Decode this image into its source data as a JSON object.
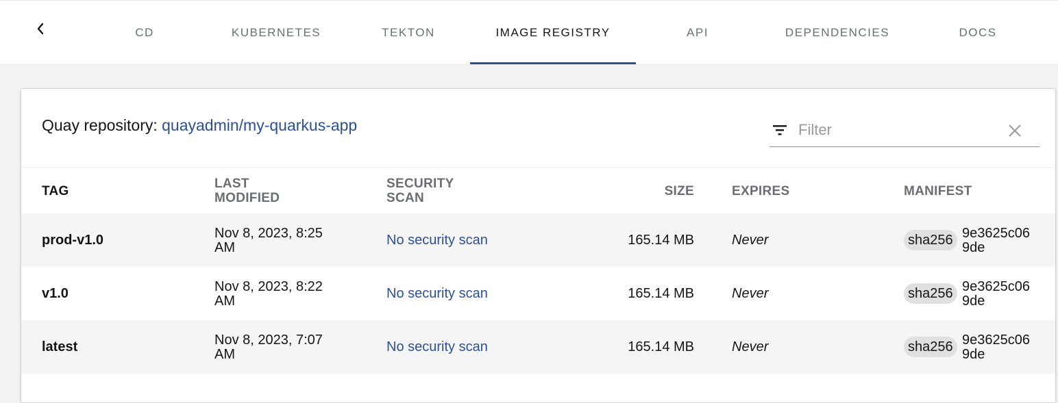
{
  "tabs": [
    {
      "label": "CD"
    },
    {
      "label": "KUBERNETES"
    },
    {
      "label": "TEKTON"
    },
    {
      "label": "IMAGE REGISTRY",
      "active": true
    },
    {
      "label": "API"
    },
    {
      "label": "DEPENDENCIES"
    },
    {
      "label": "DOCS"
    }
  ],
  "repository": {
    "prefix": "Quay repository: ",
    "name": "quayadmin/my-quarkus-app"
  },
  "filter": {
    "placeholder": "Filter",
    "value": ""
  },
  "table": {
    "columns": {
      "tag": "TAG",
      "last_modified_1": "LAST",
      "last_modified_2": "MODIFIED",
      "security_scan_1": "SECURITY",
      "security_scan_2": "SCAN",
      "size": "SIZE",
      "expires": "EXPIRES",
      "manifest": "MANIFEST"
    },
    "rows": [
      {
        "tag": "prod-v1.0",
        "modified_1": "Nov 8, 2023, 8:25",
        "modified_2": "AM",
        "scan": "No security scan",
        "size": "165.14 MB",
        "expires": "Never",
        "manifest_algo": "sha256",
        "manifest_1": "9e3625c06",
        "manifest_2": "9de"
      },
      {
        "tag": "v1.0",
        "modified_1": "Nov 8, 2023, 8:22",
        "modified_2": "AM",
        "scan": "No security scan",
        "size": "165.14 MB",
        "expires": "Never",
        "manifest_algo": "sha256",
        "manifest_1": "9e3625c06",
        "manifest_2": "9de"
      },
      {
        "tag": "latest",
        "modified_1": "Nov 8, 2023, 7:07",
        "modified_2": "AM",
        "scan": "No security scan",
        "size": "165.14 MB",
        "expires": "Never",
        "manifest_algo": "sha256",
        "manifest_1": "9e3625c06",
        "manifest_2": "9de"
      }
    ]
  },
  "colors": {
    "accent": "#2b4f9a",
    "row_shade": "#f5f5f5",
    "badge": "#e0e0e0"
  },
  "icons": {
    "back": "chevron-left-icon",
    "filter": "filter-icon",
    "clear": "close-icon"
  }
}
